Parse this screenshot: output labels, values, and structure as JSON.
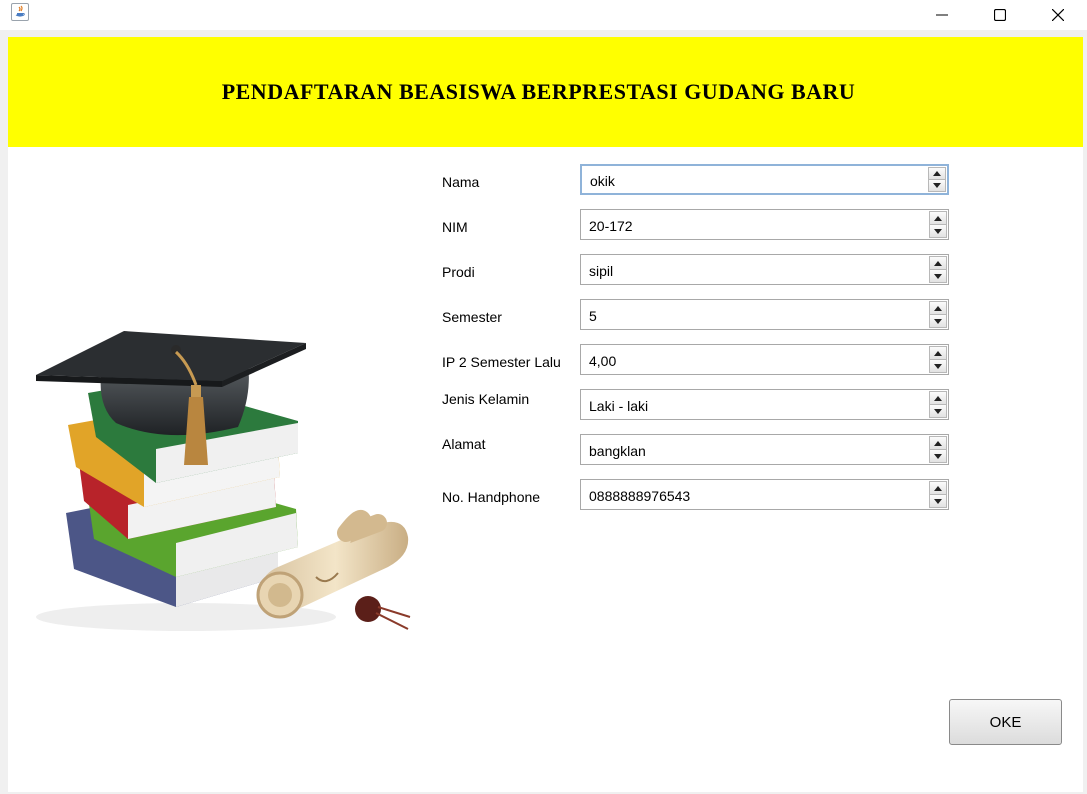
{
  "window": {
    "title_icon": "java-icon",
    "controls": [
      "minimize-icon",
      "maximize-icon",
      "close-icon"
    ]
  },
  "header": {
    "title": "PENDAFTARAN BEASISWA BERPRESTASI GUDANG BARU",
    "background": "#ffff00"
  },
  "illustration": {
    "icon": "graduation-books-illustration"
  },
  "form": {
    "fields": [
      {
        "label": "Nama",
        "value": "okik"
      },
      {
        "label": "NIM",
        "value": "20-172"
      },
      {
        "label": "Prodi",
        "value": "sipil"
      },
      {
        "label": "Semester",
        "value": "5"
      },
      {
        "label": "IP 2 Semester Lalu",
        "value": "4,00"
      },
      {
        "label": "Jenis Kelamin",
        "value": "Laki - laki"
      },
      {
        "label": "Alamat",
        "value": "bangklan"
      },
      {
        "label": "No. Handphone",
        "value": "0888888976543"
      }
    ]
  },
  "actions": {
    "ok_label": "OKE"
  }
}
